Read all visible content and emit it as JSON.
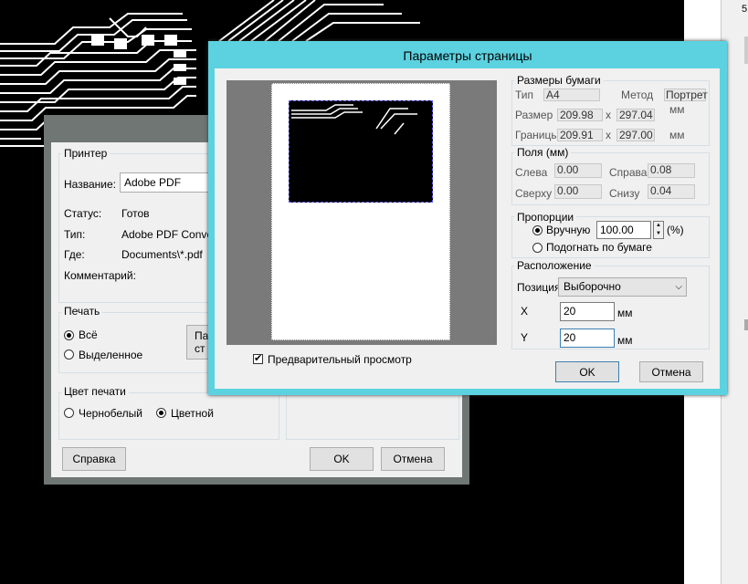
{
  "print_dialog": {
    "printer_group": "Принтер",
    "name_label": "Название:",
    "name_value": "Adobe PDF",
    "status_label": "Статус:",
    "status_value": "Готов",
    "type_label": "Тип:",
    "type_value": "Adobe PDF Convert",
    "where_label": "Где:",
    "where_value": "Documents\\*.pdf",
    "comment_label": "Комментарий:",
    "print_group": "Печать",
    "radio_all": "Всё",
    "radio_selection": "Выделенное",
    "params_button": "Па\nст",
    "color_group": "Цвет печати",
    "radio_bw": "Чернобелый",
    "radio_color": "Цветной",
    "help_button": "Справка",
    "ok_button": "OK",
    "cancel_button": "Отмена"
  },
  "setup_dialog": {
    "title": "Параметры страницы",
    "paper_group": "Размеры бумаги",
    "type_label": "Тип",
    "type_value": "A4",
    "method_label": "Метод",
    "method_value": "Портрет",
    "size_label": "Размер",
    "size_w": "209.98",
    "size_h": "297.04",
    "bounds_label": "Границы",
    "bounds_w": "209.91",
    "bounds_h": "297.00",
    "x_sep": "x",
    "unit_mm": "мм",
    "margins_group": "Поля (мм)",
    "left_label": "Слева",
    "left_value": "0.00",
    "right_label": "Справа",
    "right_value": "0.08",
    "top_label": "Сверху",
    "top_value": "0.00",
    "bottom_label": "Снизу",
    "bottom_value": "0.04",
    "proportions_group": "Пропорции",
    "manual_label": "Вручную",
    "scale_value": "100.00",
    "percent_label": "(%)",
    "fit_label": "Подогнать по бумаге",
    "position_group": "Расположение",
    "position_label": "Позиция",
    "position_value": "Выборочно",
    "x_label": "X",
    "x_value": "20",
    "y_label": "Y",
    "y_value": "20",
    "preview_label": "Предварительный просмотр",
    "ok_button": "OK",
    "cancel_button": "Отмена"
  },
  "right_panel": {
    "marker": "5"
  },
  "colors": {
    "title_bar": "#5cd2e0",
    "desktop": "#000000",
    "dialog_bg": "#f0f0f0"
  }
}
